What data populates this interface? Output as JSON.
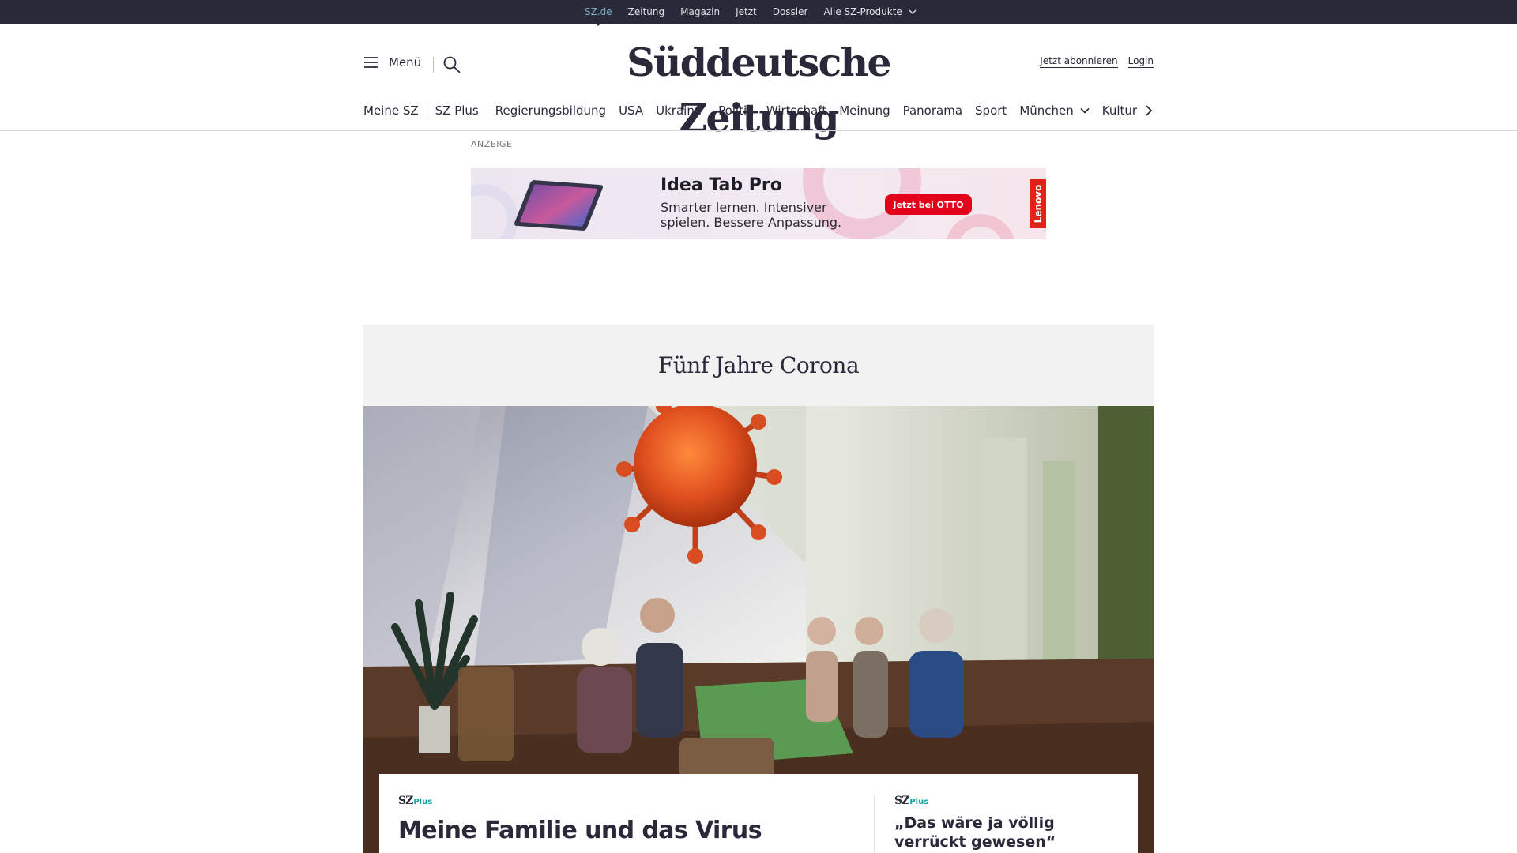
{
  "topbar": {
    "links": [
      "SZ.de",
      "Zeitung",
      "Magazin",
      "Jetzt",
      "Dossier",
      "Alle SZ-Produkte"
    ]
  },
  "header": {
    "menu_label": "Menü",
    "logo": "Süddeutsche Zeitung",
    "subscribe": "Jetzt abonnieren",
    "login": "Login"
  },
  "nav": {
    "items": [
      "Meine SZ",
      "SZ Plus",
      "Regierungsbildung",
      "USA",
      "Ukraine",
      "Politik",
      "Wirtschaft",
      "Meinung",
      "Panorama",
      "Sport",
      "München",
      "Kultur"
    ]
  },
  "ad": {
    "label": "ANZEIGE",
    "title": "Idea Tab Pro",
    "text": "Smarter lernen. Intensiver spielen. Bessere Anpassung.",
    "cta": "Jetzt bei OTTO",
    "brand": "Lenovo"
  },
  "hero": {
    "dossier_title": "Fünf Jahre Corona"
  },
  "teasers": {
    "brand_sz": "SZ",
    "brand_plus": "Plus",
    "main_headline": "Meine Familie und das Virus",
    "side_headline": "„Das wäre ja völlig verrückt gewesen“"
  },
  "colors": {
    "topbar": "#29293a",
    "active_link": "#71b0c4",
    "plus": "#0aa4a4",
    "ad_cta": "#e2001a",
    "ad_brand": "#e2231a",
    "virus": "#e0501f"
  }
}
